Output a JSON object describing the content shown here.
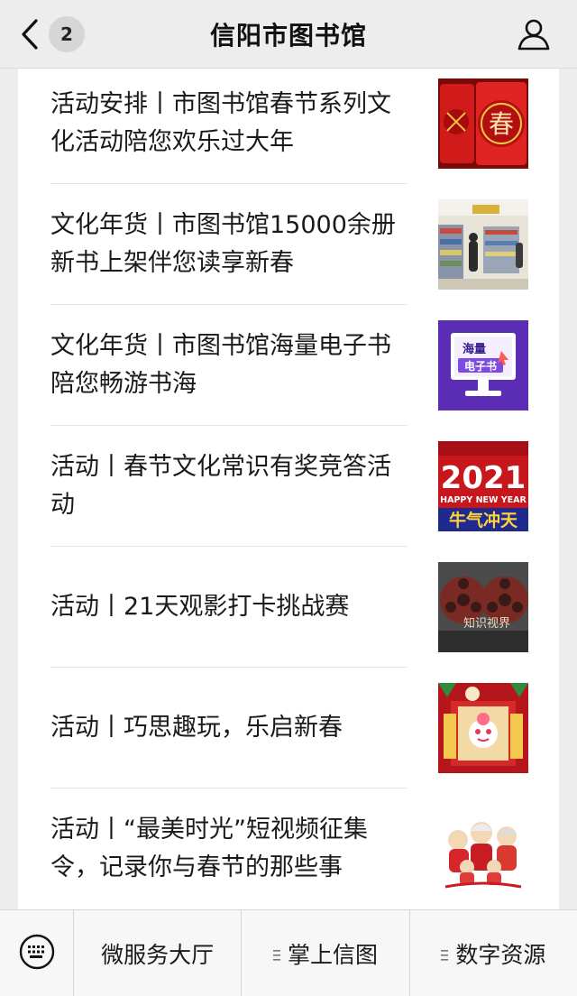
{
  "header": {
    "title": "信阳市图书馆",
    "back_count": "2",
    "back_icon": "chevron-left-icon",
    "user_icon": "user-icon"
  },
  "articles": [
    {
      "title": "活动安排丨市图书馆春节系列文化活动陪您欢乐过大年",
      "thumb": "spring-festival-red-decor"
    },
    {
      "title": "文化年货丨市图书馆15000余册新书上架伴您读享新春",
      "thumb": "library-bookshelves"
    },
    {
      "title": "文化年货丨市图书馆海量电子书陪您畅游书海",
      "thumb": "ebook-monitor",
      "thumb_text": [
        "海量",
        "电子书"
      ]
    },
    {
      "title": "活动丨春节文化常识有奖竞答活动",
      "thumb": "year-2021-poster",
      "thumb_text": [
        "2021",
        "HAPPY NEW YEAR",
        "牛气冲天"
      ]
    },
    {
      "title": "活动丨21天观影打卡挑战赛",
      "thumb": "film-reels",
      "thumb_text": [
        "知识视界"
      ]
    },
    {
      "title": "活动丨巧思趣玩，乐启新春",
      "thumb": "festival-cartoon"
    },
    {
      "title": "活动丨“最美时光”短视频征集令，记录你与春节的那些事",
      "thumb": "family-cartoon"
    }
  ],
  "bottom_nav": {
    "keyboard_icon": "keyboard-icon",
    "items": [
      "微服务大厅",
      "掌上信图",
      "数字资源"
    ]
  },
  "colors": {
    "background": "#ededed",
    "card": "#ffffff",
    "festival_red": "#c8161d",
    "ebook_purple": "#5b2db5"
  }
}
